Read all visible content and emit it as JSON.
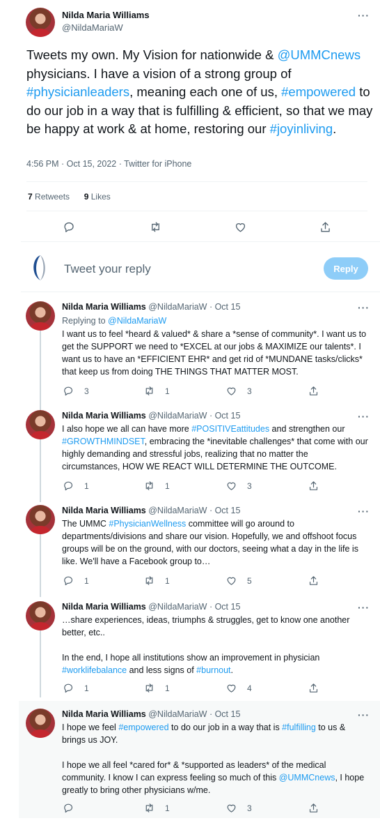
{
  "main_tweet": {
    "author_name": "Nilda Maria Williams",
    "author_handle": "@NildaMariaW",
    "more_icon": "ellipsis-icon",
    "text_parts": [
      {
        "text": "Tweets my own. My Vision for nationwide & ",
        "link": false
      },
      {
        "text": "@UMMCnews",
        "link": true
      },
      {
        "text": " physicians. I have a vision of a strong group of ",
        "link": false
      },
      {
        "text": "#physicianleaders",
        "link": true
      },
      {
        "text": ", meaning each one of us, ",
        "link": false
      },
      {
        "text": "#empowered",
        "link": true
      },
      {
        "text": " to do our job in a way that is fulfilling & efficient, so that we may be happy at work & at home, restoring our ",
        "link": false
      },
      {
        "text": "#joyinliving",
        "link": true
      },
      {
        "text": ".",
        "link": false
      }
    ],
    "meta": "4:56 PM · Oct 15, 2022 · Twitter for iPhone",
    "retweets_count": "7",
    "retweets_label": " Retweets",
    "likes_count": "9",
    "likes_label": " Likes"
  },
  "reply_box": {
    "placeholder": "Tweet your reply",
    "button_label": "Reply"
  },
  "replies": [
    {
      "name": "Nilda Maria Williams",
      "handle_date": "@NildaMariaW · Oct 15",
      "replying_to_label": "Replying to ",
      "replying_to_handle": "@NildaMariaW",
      "paragraphs": [
        [
          {
            "text": "I want us to feel *heard & valued* & share a *sense of community*. I want us to get the SUPPORT we need to *EXCEL at our jobs & MAXIMIZE our talents*. I want us to have an *EFFICIENT EHR* and get rid of *MUNDANE tasks/clicks* that keep us from doing THE THINGS THAT MATTER MOST.",
            "link": false
          }
        ]
      ],
      "replies": "3",
      "retweets": "1",
      "likes": "3"
    },
    {
      "name": "Nilda Maria Williams",
      "handle_date": "@NildaMariaW · Oct 15",
      "paragraphs": [
        [
          {
            "text": "I also hope we all can have more ",
            "link": false
          },
          {
            "text": "#POSITIVEattitudes",
            "link": true
          },
          {
            "text": " and strengthen our ",
            "link": false
          },
          {
            "text": "#GROWTHMINDSET",
            "link": true
          },
          {
            "text": ", embracing the *inevitable challenges* that come with our highly demanding and stressful jobs, realizing that no matter the circumstances, HOW WE REACT WILL DETERMINE THE OUTCOME.",
            "link": false
          }
        ]
      ],
      "replies": "1",
      "retweets": "1",
      "likes": "3"
    },
    {
      "name": "Nilda Maria Williams",
      "handle_date": "@NildaMariaW · Oct 15",
      "paragraphs": [
        [
          {
            "text": "The UMMC ",
            "link": false
          },
          {
            "text": "#PhysicianWellness",
            "link": true
          },
          {
            "text": " committee will go around to departments/divisions and share our vision. Hopefully, we and offshoot focus groups will be on the ground, with our doctors, seeing what a day in the life is like. We'll have a Facebook group to…",
            "link": false
          }
        ]
      ],
      "replies": "1",
      "retweets": "1",
      "likes": "5"
    },
    {
      "name": "Nilda Maria Williams",
      "handle_date": "@NildaMariaW · Oct 15",
      "paragraphs": [
        [
          {
            "text": "…share experiences, ideas, triumphs & struggles, get to know one another better, etc..",
            "link": false
          }
        ],
        [
          {
            "text": "In the end, I hope all institutions show an improvement in physician ",
            "link": false
          },
          {
            "text": "#worklifebalance",
            "link": true
          },
          {
            "text": " and less signs of ",
            "link": false
          },
          {
            "text": "#burnout",
            "link": true
          },
          {
            "text": ".",
            "link": false
          }
        ]
      ],
      "replies": "1",
      "retweets": "1",
      "likes": "4"
    },
    {
      "name": "Nilda Maria Williams",
      "handle_date": "@NildaMariaW · Oct 15",
      "paragraphs": [
        [
          {
            "text": "I hope we feel ",
            "link": false
          },
          {
            "text": "#empowered",
            "link": true
          },
          {
            "text": " to do our job in a way that is ",
            "link": false
          },
          {
            "text": "#fulfilling",
            "link": true
          },
          {
            "text": " to us & brings us JOY.",
            "link": false
          }
        ],
        [
          {
            "text": "I hope we all feel *cared for* & *supported as leaders* of the medical community. I know I can express feeling so much of this ",
            "link": false
          },
          {
            "text": "@UMMCnews",
            "link": true
          },
          {
            "text": ", I hope greatly to bring other physicians w/me.",
            "link": false
          }
        ]
      ],
      "replies": "",
      "retweets": "1",
      "likes": "3"
    }
  ]
}
